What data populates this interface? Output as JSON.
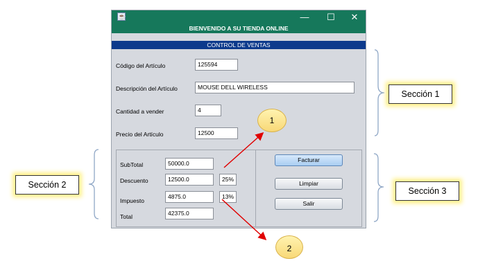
{
  "window": {
    "header_title": "BIENVENIDO A SU TIENDA ONLINE",
    "section_title": "CONTROL DE VENTAS",
    "controls": {
      "minimize": "—",
      "maximize": "☐",
      "close": "✕"
    }
  },
  "form": {
    "codigo": {
      "label": "Código del Artículo",
      "value": "125594"
    },
    "descripcion": {
      "label": "Descripción del Artículo",
      "value": "MOUSE DELL WIRELESS"
    },
    "cantidad": {
      "label": "Cantidad a vender",
      "value": "4"
    },
    "precio": {
      "label": "Precio del Artículo",
      "value": "12500"
    }
  },
  "totals": {
    "subtotal": {
      "label": "SubTotal",
      "value": "50000.0"
    },
    "descuento": {
      "label": "Descuento",
      "value": "12500.0",
      "percent": "25%"
    },
    "impuesto": {
      "label": "Impuesto",
      "value": "4875.0",
      "percent": "13%"
    },
    "total": {
      "label": "Total",
      "value": "42375.0"
    }
  },
  "buttons": {
    "facturar": "Facturar",
    "limpiar": "Limpiar",
    "salir": "Salir"
  },
  "annotations": {
    "seccion1": "Sección 1",
    "seccion2": "Sección 2",
    "seccion3": "Sección 3",
    "marker1": "1",
    "marker2": "2"
  },
  "colors": {
    "titlebar": "#16785b",
    "section_band": "#0c3a8c",
    "arrow": "#e00000",
    "bracket": "#8fa7c6",
    "callout_glow": "#fff18a"
  }
}
